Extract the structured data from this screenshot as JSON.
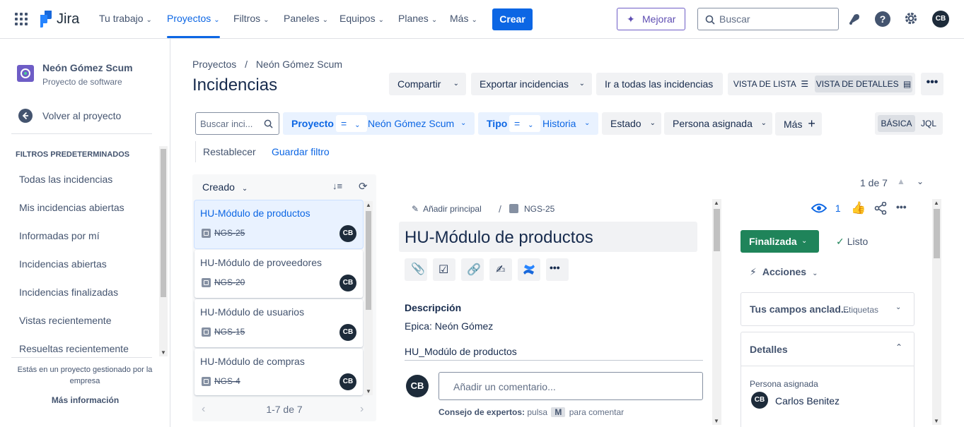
{
  "topnav": {
    "logo_text": "Jira",
    "items": [
      "Tu trabajo",
      "Proyectos",
      "Filtros",
      "Paneles",
      "Equipos",
      "Planes",
      "Más"
    ],
    "create_label": "Crear",
    "improve_label": "Mejorar",
    "search_placeholder": "Buscar",
    "avatar_initials": "CB"
  },
  "sidebar": {
    "project_name": "Neón Gómez Scum",
    "project_type": "Proyecto de software",
    "back_label": "Volver al proyecto",
    "section_title": "FILTROS PREDETERMINADOS",
    "filters": [
      "Todas las incidencias",
      "Mis incidencias abiertas",
      "Informadas por mí",
      "Incidencias abiertas",
      "Incidencias finalizadas",
      "Vistas recientemente",
      "Resueltas recientemente"
    ],
    "footer_text": "Estás en un proyecto gestionado por la empresa",
    "footer_link": "Más información"
  },
  "header": {
    "breadcrumb_root": "Proyectos",
    "breadcrumb_sep": "/",
    "breadcrumb_project": "Neón Gómez Scum",
    "title": "Incidencias",
    "share_label": "Compartir",
    "export_label": "Exportar incidencias",
    "goto_all_label": "Ir a todas las incidencias",
    "list_view_label": "VISTA DE LISTA",
    "detail_view_label": "VISTA DE DETALLES"
  },
  "filters": {
    "search_placeholder": "Buscar inci...",
    "project_label": "Proyecto",
    "project_op": "=",
    "project_value": "Neón Gómez Scum",
    "type_label": "Tipo",
    "type_op": "=",
    "type_value": "Historia",
    "status_label": "Estado",
    "assignee_label": "Persona asignada",
    "more_label": "Más",
    "basic_label": "BÁSICA",
    "jql_label": "JQL",
    "reset_label": "Restablecer",
    "save_label": "Guardar filtro"
  },
  "list": {
    "sort_label": "Creado",
    "pagination": "1-7 de 7",
    "issues": [
      {
        "title": "HU-Módulo de productos",
        "key": "NGS-25",
        "assignee": "CB",
        "selected": true
      },
      {
        "title": "HU-Módulo de proveedores",
        "key": "NGS-20",
        "assignee": "CB",
        "selected": false
      },
      {
        "title": "HU-Módulo de usuarios",
        "key": "NGS-15",
        "assignee": "CB",
        "selected": false
      },
      {
        "title": "HU-Módulo de compras",
        "key": "NGS-4",
        "assignee": "CB",
        "selected": false
      }
    ]
  },
  "detail": {
    "position": "1 de 7",
    "add_parent_label": "Añadir principal",
    "crumb_sep": "/",
    "issue_key": "NGS-25",
    "title": "HU-Módulo de productos",
    "description_heading": "Descripción",
    "description_line1": "Epica: Neón Gómez",
    "description_line2": "HU_Modúlo de productos",
    "comment_placeholder": "Añadir un comentario...",
    "commenter_initials": "CB",
    "tip_bold": "Consejo de expertos:",
    "tip_press": "pulsa",
    "tip_key": "M",
    "tip_rest": "para comentar",
    "watchers": "1",
    "status_label": "Finalizada",
    "resolution_label": "Listo",
    "actions_label": "Acciones",
    "pinned_label": "Tus campos anclad...",
    "pinned_tag": "Etiquetas",
    "details_label": "Detalles",
    "assignee_field": "Persona asignada",
    "assignee_name": "Carlos Benitez",
    "assignee_initials": "CB"
  },
  "colors": {
    "brand": "#0c66e4",
    "status_done": "#1f845a",
    "selected_card": "#e9f2ff",
    "avatar": "#1d2b3a"
  }
}
